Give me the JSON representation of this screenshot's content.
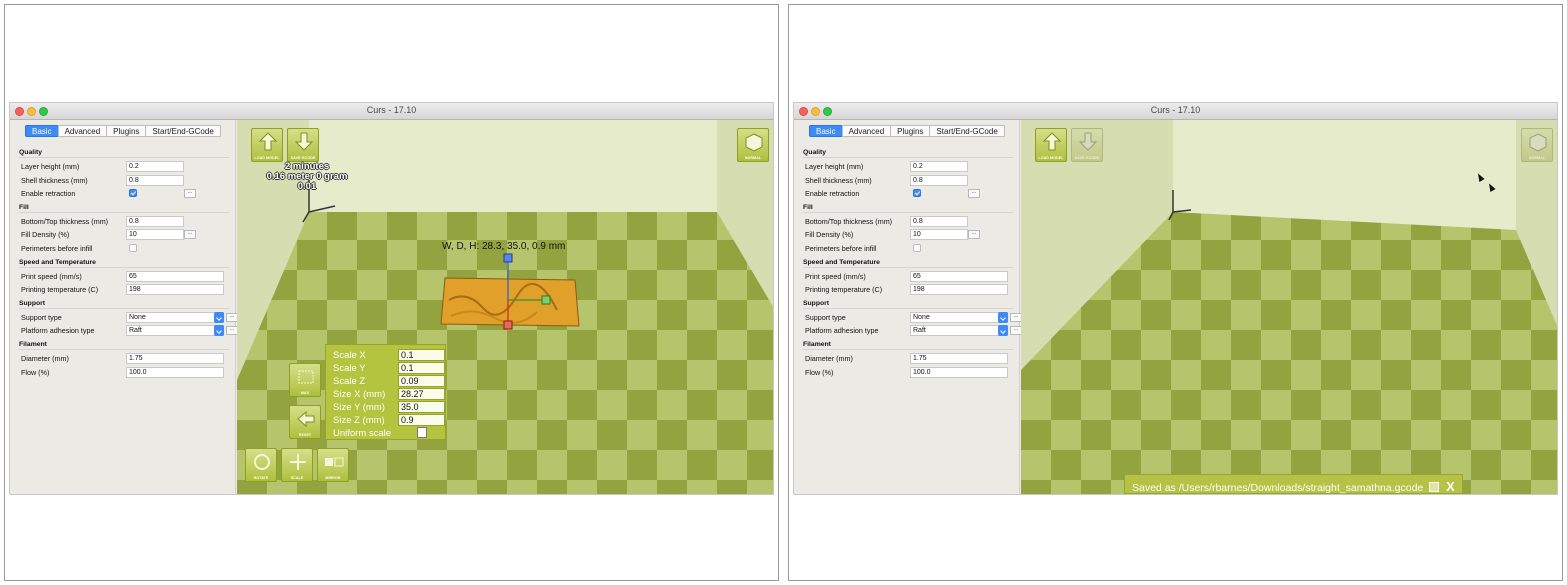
{
  "left": {
    "window_title": "Curs - 17.10",
    "tabs": [
      "Basic",
      "Advanced",
      "Plugins",
      "Start/End-GCode"
    ],
    "sections": {
      "quality": "Quality",
      "fill": "Fill",
      "speed": "Speed and Temperature",
      "support": "Support",
      "filament": "Filament"
    },
    "fields": {
      "layer_height": {
        "label": "Layer height (mm)",
        "value": "0.2"
      },
      "shell_thickness": {
        "label": "Shell thickness (mm)",
        "value": "0.8"
      },
      "enable_retraction": {
        "label": "Enable retraction",
        "checked": true
      },
      "bottom_top": {
        "label": "Bottom/Top thickness (mm)",
        "value": "0.8"
      },
      "fill_density": {
        "label": "Fill Density (%)",
        "value": "10"
      },
      "perimeters": {
        "label": "Perimeters before infill",
        "checked": false
      },
      "print_speed": {
        "label": "Print speed (mm/s)",
        "value": "65"
      },
      "print_temp": {
        "label": "Printing temperature (C)",
        "value": "198"
      },
      "support_type": {
        "label": "Support type",
        "value": "None"
      },
      "adhesion": {
        "label": "Platform adhesion type",
        "value": "Raft"
      },
      "diameter": {
        "label": "Diameter (mm)",
        "value": "1.75"
      },
      "flow": {
        "label": "Flow (%)",
        "value": "100.0"
      }
    },
    "ellipsis": "...",
    "viewport": {
      "btn_load": "LOAD MODEL",
      "btn_save": "SAVE GCODE",
      "btn_view": "NORMAL",
      "estimate": [
        "2 minutes",
        "0.16 meter 0 gram",
        "0.01"
      ],
      "dims": "W, D, H: 28.3, 35.0, 0.9 mm",
      "btn_max": "MAX",
      "btn_reset": "RESET",
      "btn_rotate": "ROTATE",
      "btn_scale": "SCALE",
      "btn_mirror": "MIRROR",
      "scale_panel": {
        "scale_x": {
          "label": "Scale X",
          "value": "0.1"
        },
        "scale_y": {
          "label": "Scale Y",
          "value": "0.1"
        },
        "scale_z": {
          "label": "Scale Z",
          "value": "0.09"
        },
        "size_x": {
          "label": "Size X (mm)",
          "value": "28.27"
        },
        "size_y": {
          "label": "Size Y (mm)",
          "value": "35.0"
        },
        "size_z": {
          "label": "Size Z (mm)",
          "value": "0.9"
        },
        "uniform": "Uniform scale"
      }
    }
  },
  "right": {
    "window_title": "Curs - 17.10",
    "tabs": [
      "Basic",
      "Advanced",
      "Plugins",
      "Start/End-GCode"
    ],
    "sections": {
      "quality": "Quality",
      "fill": "Fill",
      "speed": "Speed and Temperature",
      "support": "Support",
      "filament": "Filament"
    },
    "fields": {
      "layer_height": {
        "label": "Layer height (mm)",
        "value": "0.2"
      },
      "shell_thickness": {
        "label": "Shell thickness (mm)",
        "value": "0.8"
      },
      "enable_retraction": {
        "label": "Enable retraction",
        "checked": true
      },
      "bottom_top": {
        "label": "Bottom/Top thickness (mm)",
        "value": "0.8"
      },
      "fill_density": {
        "label": "Fill Density (%)",
        "value": "10"
      },
      "perimeters": {
        "label": "Perimeters before infill",
        "checked": false
      },
      "print_speed": {
        "label": "Print speed (mm/s)",
        "value": "65"
      },
      "print_temp": {
        "label": "Printing temperature (C)",
        "value": "198"
      },
      "support_type": {
        "label": "Support type",
        "value": "None"
      },
      "adhesion": {
        "label": "Platform adhesion type",
        "value": "Raft"
      },
      "diameter": {
        "label": "Diameter (mm)",
        "value": "1.75"
      },
      "flow": {
        "label": "Flow (%)",
        "value": "100.0"
      }
    },
    "ellipsis": "...",
    "viewport": {
      "btn_load": "LOAD MODEL",
      "btn_save": "SAVE GCODE",
      "btn_view": "NORMAL",
      "toast": "Saved as /Users/rbarnes/Downloads/straight_samathna.gcode",
      "toast_close": "X"
    }
  },
  "colors": {
    "accent_blue": "#3e8af7",
    "floor_light": "#b6c46c",
    "floor_dark": "#93a33f",
    "wall": "#dde4b8",
    "ui_green": "#b4c43f",
    "model_orange": "#e0a02a"
  }
}
